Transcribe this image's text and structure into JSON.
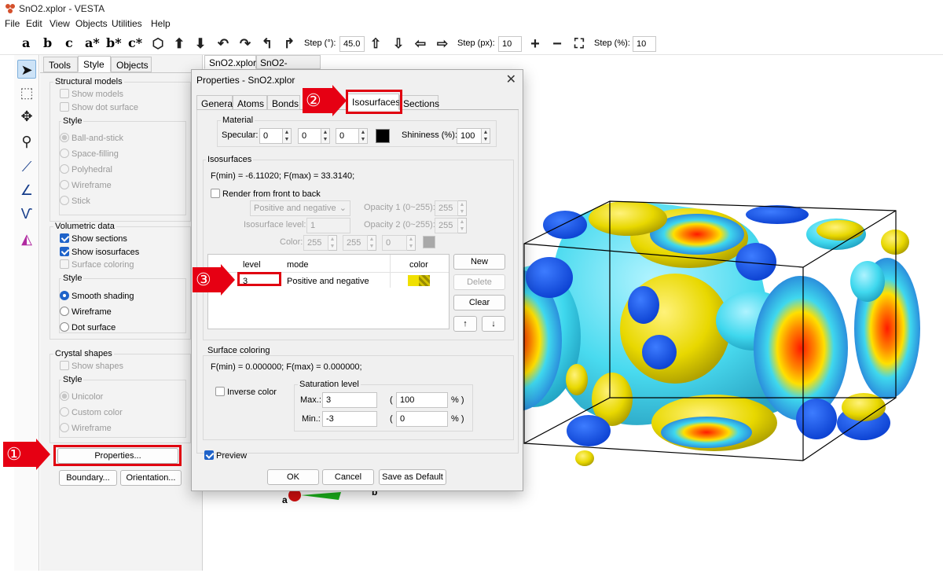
{
  "window": {
    "title": "SnO2.xplor - VESTA"
  },
  "menu": [
    "File",
    "Edit",
    "View",
    "Objects",
    "Utilities",
    "Help"
  ],
  "toolbar": {
    "axes": [
      "a",
      "b",
      "c",
      "a*",
      "b*",
      "c*"
    ],
    "step_deg_label": "Step (°):",
    "step_deg_value": "45.0",
    "step_px_label": "Step (px):",
    "step_px_value": "10",
    "step_pct_label": "Step (%):",
    "step_pct_value": "10"
  },
  "left_tools": [
    "select-arrow-icon",
    "select-region-icon",
    "translate-icon",
    "magnify-icon",
    "distance-icon",
    "angle-icon",
    "dihedral-icon",
    "boundary-icon"
  ],
  "side_panel": {
    "tabs": [
      "Tools",
      "Style",
      "Objects"
    ],
    "active_tab": "Style",
    "structural": {
      "title": "Structural models",
      "show_models": "Show models",
      "show_dot_surface": "Show dot surface",
      "style_title": "Style",
      "styles": [
        "Ball-and-stick",
        "Space-filling",
        "Polyhedral",
        "Wireframe",
        "Stick"
      ]
    },
    "volumetric": {
      "title": "Volumetric data",
      "show_sections": "Show sections",
      "show_isosurfaces": "Show isosurfaces",
      "surface_coloring": "Surface coloring",
      "style_title": "Style",
      "styles": [
        "Smooth shading",
        "Wireframe",
        "Dot surface"
      ]
    },
    "crystal": {
      "title": "Crystal shapes",
      "show_shapes": "Show shapes",
      "style_title": "Style",
      "styles": [
        "Unicolor",
        "Custom color",
        "Wireframe"
      ]
    },
    "buttons": {
      "properties": "Properties...",
      "boundary": "Boundary...",
      "orientation": "Orientation..."
    }
  },
  "doc_tabs": [
    "SnO2.xplor",
    "SnO2-EDMA.cif"
  ],
  "dialog": {
    "title": "Properties - SnO2.xplor",
    "tabs": [
      "General",
      "Atoms",
      "Bonds",
      "Isosurfaces",
      "Sections"
    ],
    "active_tab": "Isosurfaces",
    "material": {
      "title": "Material",
      "specular_label": "Specular:",
      "specular": [
        "0",
        "0",
        "0"
      ],
      "specular_color": "#000000",
      "shininess_label": "Shininess (%):",
      "shininess": "100"
    },
    "isosurfaces": {
      "title": "Isosurfaces",
      "fminmax": "F(min) = -6.11020;   F(max) = 33.3140;",
      "render_front_back": "Render from front to back",
      "mode_select": "Positive and negative",
      "opacity1_label": "Opacity 1 (0~255):",
      "opacity1": "255",
      "opacity2_label": "Opacity 2 (0~255):",
      "opacity2": "255",
      "level_label": "Isosurface level:",
      "level": "1",
      "color_label": "Color:",
      "color_values": [
        "255",
        "255",
        "0"
      ],
      "table_headers": [
        "level",
        "mode",
        "color"
      ],
      "rows": [
        {
          "level": "3",
          "mode": "Positive and negative"
        }
      ],
      "buttons": {
        "new": "New",
        "delete": "Delete",
        "clear": "Clear",
        "up": "↑",
        "down": "↓"
      }
    },
    "surface_coloring": {
      "title": "Surface coloring",
      "fminmax": "F(min) = 0.000000;   F(max) = 0.000000;",
      "inverse_color": "Inverse color",
      "saturation_title": "Saturation level",
      "max_label": "Max.:",
      "max": "3",
      "max_pct": "100",
      "min_label": "Min.:",
      "min": "-3",
      "min_pct": "0",
      "open_paren": "(",
      "close_pct": "% )"
    },
    "preview": "Preview",
    "footer": {
      "ok": "OK",
      "cancel": "Cancel",
      "save_default": "Save as Default"
    }
  },
  "annotations": [
    "①",
    "②",
    "③"
  ],
  "axis_labels": {
    "a": "a",
    "b": "b"
  },
  "colors": {
    "accent": "#1f63c9",
    "annotation_red": "#e60013",
    "isosurface_yellow": "#e8e000",
    "isosurface_cyan": "#3fd8ee"
  }
}
